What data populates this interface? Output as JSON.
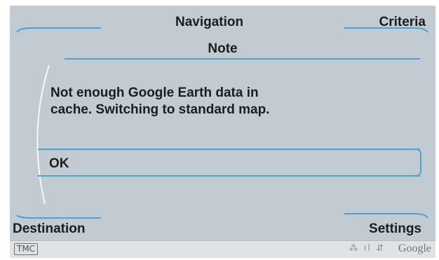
{
  "header": {
    "left_softkey": "",
    "center_label": "Navigation",
    "right_softkey": "Criteria"
  },
  "dialog": {
    "title": "Note",
    "message_line1": "Not enough Google Earth data in",
    "message_line2": "cache. Switching to standard map.",
    "ok_label": "OK"
  },
  "footer": {
    "left_softkey": "Destination",
    "right_softkey": "Settings"
  },
  "statusbar": {
    "tmc_label": "TMC",
    "status_icons": "⁂ ıl ⇵",
    "google_label": "Google"
  },
  "colors": {
    "screen_background": "#c2cbd2",
    "accent_line": "#4aa3d2",
    "text": "#1d1d1f"
  }
}
